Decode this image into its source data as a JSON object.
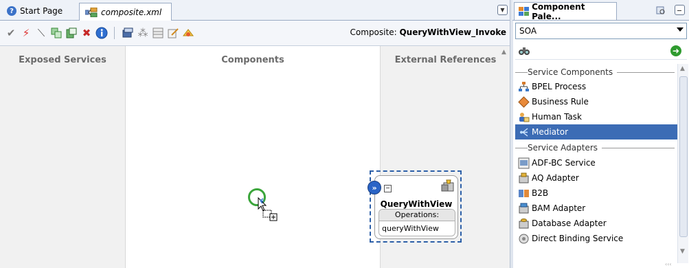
{
  "editor_tabs": [
    {
      "label": "Start Page"
    },
    {
      "label": "composite.xml"
    }
  ],
  "toolbar": {
    "composite_prefix": "Composite:",
    "composite_name": "QueryWithView_Invoke"
  },
  "canvas": {
    "lanes": [
      "Exposed Services",
      "Components",
      "External References"
    ],
    "reference": {
      "name": "QueryWithView",
      "ops_header": "Operations:",
      "operation": "queryWithView"
    }
  },
  "palette": {
    "tab_label": "Component Pale...",
    "category": "SOA",
    "search_value": "",
    "groups": [
      {
        "label": "Service Components",
        "items": [
          {
            "label": "BPEL Process",
            "icon": "bpel-process-icon"
          },
          {
            "label": "Business Rule",
            "icon": "business-rule-icon"
          },
          {
            "label": "Human Task",
            "icon": "human-task-icon"
          },
          {
            "label": "Mediator",
            "icon": "mediator-icon"
          }
        ]
      },
      {
        "label": "Service Adapters",
        "items": [
          {
            "label": "ADF-BC Service",
            "icon": "adf-bc-icon"
          },
          {
            "label": "AQ Adapter",
            "icon": "aq-adapter-icon"
          },
          {
            "label": "B2B",
            "icon": "b2b-icon"
          },
          {
            "label": "BAM Adapter",
            "icon": "bam-adapter-icon"
          },
          {
            "label": "Database Adapter",
            "icon": "database-adapter-icon"
          },
          {
            "label": "Direct Binding Service",
            "icon": "direct-binding-icon"
          }
        ]
      }
    ],
    "selected_item": "Mediator"
  },
  "colors": {
    "selection": "#3c6cb5",
    "drop_border": "#2c5fa8",
    "drag_ring": "#3aa53a"
  }
}
